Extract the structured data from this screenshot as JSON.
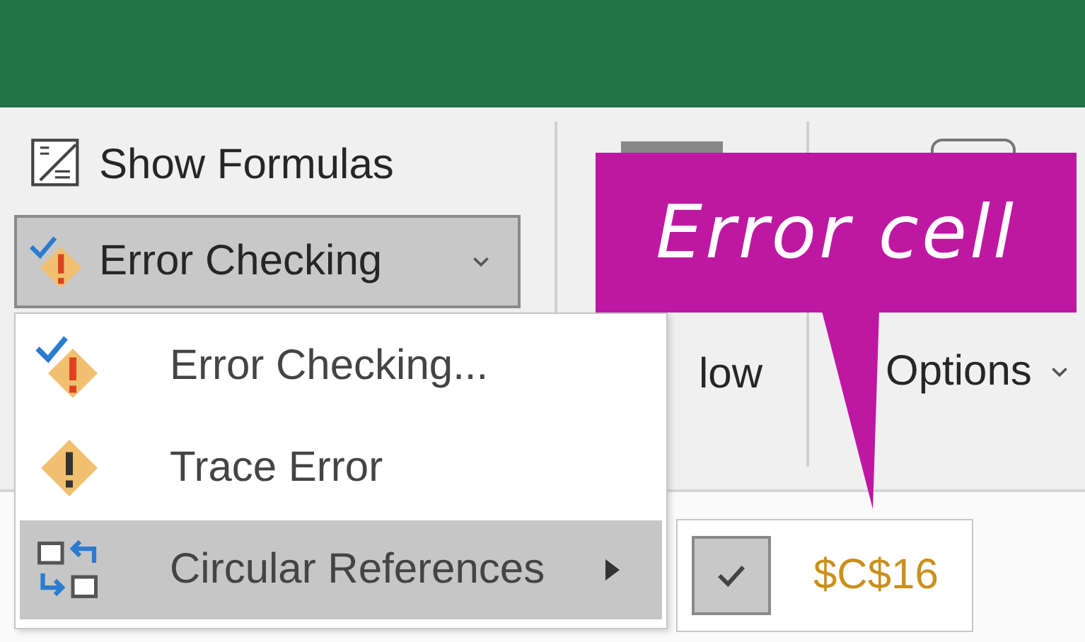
{
  "ribbon": {
    "show_formulas": "Show Formulas",
    "error_checking": {
      "label": "Error Checking",
      "pressed": true
    },
    "watch_window_fragment": "low",
    "calculation_options": "Options"
  },
  "menu": {
    "items": [
      {
        "kind": "check",
        "label": "Error Checking...",
        "selected": false,
        "submenu": false
      },
      {
        "kind": "trace",
        "label": "Trace Error",
        "selected": false,
        "submenu": false
      },
      {
        "kind": "circular",
        "label": "Circular References",
        "selected": true,
        "submenu": true
      }
    ]
  },
  "submenu": {
    "items": [
      {
        "label": "$C$16",
        "checked": true
      }
    ]
  },
  "callout": {
    "text": "Error cell"
  }
}
